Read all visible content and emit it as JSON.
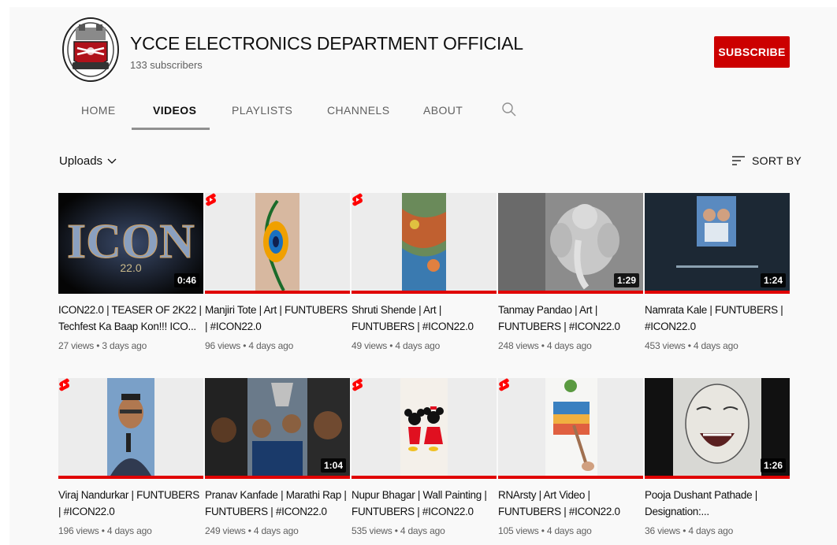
{
  "channel": {
    "title": "YCCE ELECTRONICS DEPARTMENT OFFICIAL",
    "subscribers": "133 subscribers",
    "subscribe_label": "SUBSCRIBE"
  },
  "tabs": [
    {
      "label": "HOME"
    },
    {
      "label": "VIDEOS",
      "active": true
    },
    {
      "label": "PLAYLISTS"
    },
    {
      "label": "CHANNELS"
    },
    {
      "label": "ABOUT"
    }
  ],
  "filter": {
    "uploads_label": "Uploads",
    "sort_label": "SORT BY"
  },
  "icons": {
    "search": "search-icon",
    "sort": "sort-icon",
    "dropdown": "chevron-down-icon",
    "shorts": "shorts-icon"
  },
  "colors": {
    "subscribe": "#cc0000",
    "progress": "#e00000",
    "shorts": "#ff0000"
  },
  "videos": [
    {
      "title": "ICON22.0 | TEASER OF 2K22 | Techfest Ka Baap Kon!!! ICO...",
      "meta": "27 views • 3 days ago",
      "duration": "0:46",
      "thumb_text": "ICON",
      "thumb_sub": "22.0"
    },
    {
      "title": "Manjiri Tote | Art | FUNTUBERS | #ICON22.0",
      "meta": "96 views • 4 days ago",
      "duration": ""
    },
    {
      "title": "Shruti Shende | Art | FUNTUBERS | #ICON22.0",
      "meta": "49 views • 4 days ago",
      "duration": ""
    },
    {
      "title": "Tanmay Pandao | Art | FUNTUBERS | #ICON22.0",
      "meta": "248 views • 4 days ago",
      "duration": "1:29"
    },
    {
      "title": "Namrata Kale | FUNTUBERS | #ICON22.0",
      "meta": "453 views • 4 days ago",
      "duration": "1:24"
    },
    {
      "title": "Viraj Nandurkar | FUNTUBERS | #ICON22.0",
      "meta": "196 views • 4 days ago",
      "duration": ""
    },
    {
      "title": "Pranav Kanfade | Marathi Rap | FUNTUBERS | #ICON22.0",
      "meta": "249 views • 4 days ago",
      "duration": "1:04"
    },
    {
      "title": "Nupur Bhagar | Wall Painting | FUNTUBERS | #ICON22.0",
      "meta": "535 views • 4 days ago",
      "duration": ""
    },
    {
      "title": "RNArsty | Art Video | FUNTUBERS | #ICON22.0",
      "meta": "105 views • 4 days ago",
      "duration": ""
    },
    {
      "title": "Pooja Dushant Pathade | Designation:...",
      "meta": "36 views • 4 days ago",
      "duration": "1:26"
    }
  ]
}
